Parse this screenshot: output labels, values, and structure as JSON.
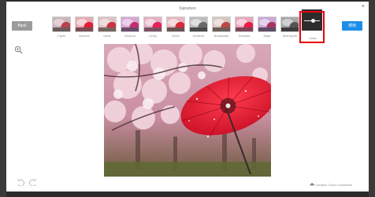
{
  "dialog": {
    "title": "Signature",
    "close_glyph": "×"
  },
  "toolbar": {
    "back_label": "Back",
    "apply_label": "適用"
  },
  "filters": [
    {
      "label": "Clyde"
    },
    {
      "label": "Avenue"
    },
    {
      "label": "Haas"
    },
    {
      "label": "Arizona"
    },
    {
      "label": "Lucky"
    },
    {
      "label": "Dean"
    },
    {
      "label": "Keylime"
    },
    {
      "label": "Boardwalk"
    },
    {
      "label": "Sentosa"
    },
    {
      "label": "Sage"
    },
    {
      "label": "Metropolis"
    },
    {
      "label": "Clear",
      "selected": true
    }
  ],
  "status": {
    "text": "Creative Cloud Connected"
  },
  "icons": {
    "zoom": "zoom-in-icon",
    "undo": "undo-icon",
    "redo": "redo-icon",
    "cloud": "creative-cloud-icon",
    "close": "close-icon"
  },
  "colors": {
    "apply": "#1b8ee8",
    "back": "#9b9b9b",
    "selection": "#e60012",
    "umbrella": "#e0152b"
  }
}
